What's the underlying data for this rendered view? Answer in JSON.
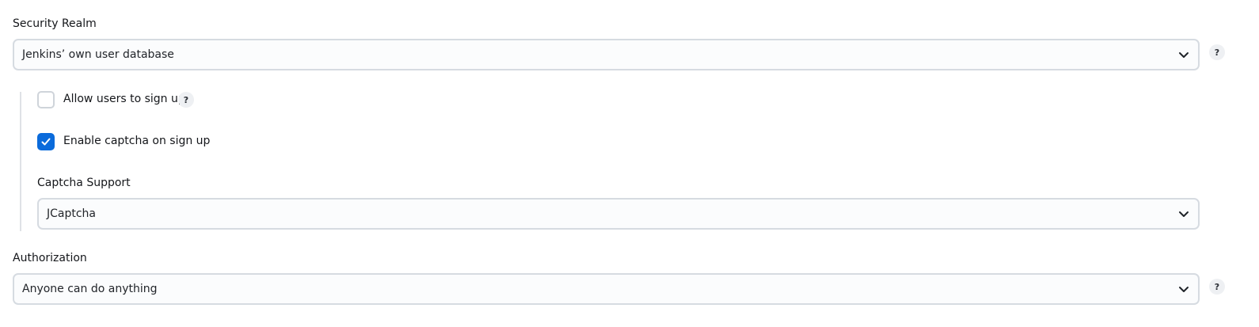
{
  "security_realm": {
    "label": "Security Realm",
    "selected": "Jenkins’ own user database",
    "help": "?"
  },
  "signup": {
    "allow_label": "Allow users to sign up",
    "allow_checked": false,
    "allow_help": "?",
    "captcha_label": "Enable captcha on sign up",
    "captcha_checked": true
  },
  "captcha_support": {
    "label": "Captcha Support",
    "selected": "JCaptcha"
  },
  "authorization": {
    "label": "Authorization",
    "selected": "Anyone can do anything",
    "help": "?"
  },
  "icons": {
    "chevron": "chevron-down-icon",
    "check": "check-icon",
    "help": "help-icon"
  },
  "colors": {
    "accent": "#0b6bdb",
    "border": "#d6dbe1",
    "help_bg": "#eef0f3"
  }
}
